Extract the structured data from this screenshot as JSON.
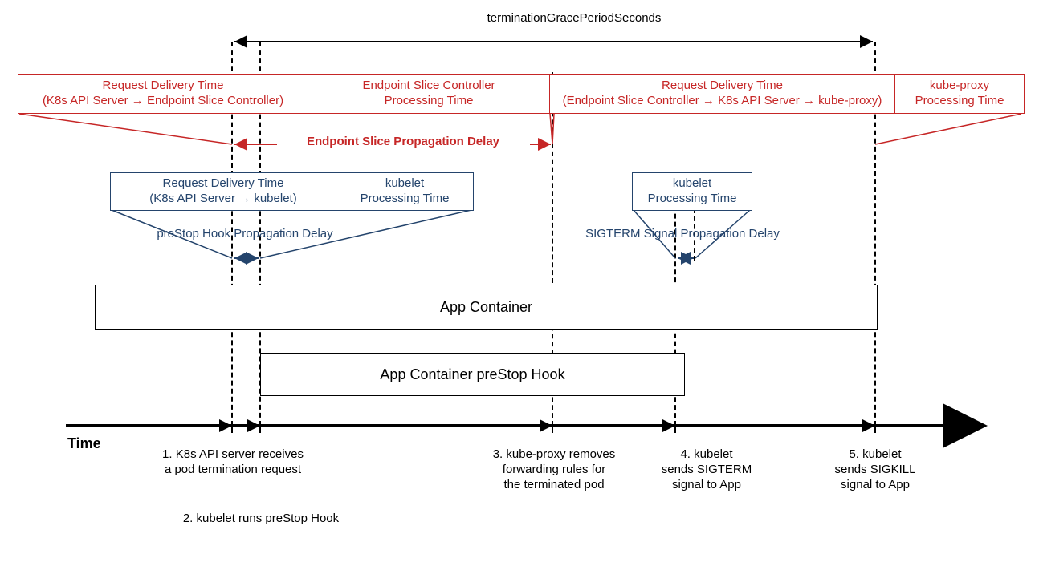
{
  "topSpanLabel": "terminationGracePeriodSeconds",
  "redRow": {
    "b1": {
      "l1": "Request Delivery Time",
      "l2": "(K8s API Server → Endpoint Slice Controller)"
    },
    "b2": {
      "l1": "Endpoint Slice Controller",
      "l2": "Processing Time"
    },
    "b3": {
      "l1": "Request Delivery Time",
      "l2": "(Endpoint Slice Controller → K8s API Server → kube-proxy)"
    },
    "b4": {
      "l1": "kube-proxy",
      "l2": "Processing Time"
    }
  },
  "redSpanLabel": "Endpoint Slice Propagation Delay",
  "blueRow": {
    "b1": {
      "l1": "Request Delivery Time",
      "l2": "(K8s API Server → kubelet)"
    },
    "b2": {
      "l1": "kubelet",
      "l2": "Processing Time"
    },
    "b3": {
      "l1": "kubelet",
      "l2": "Processing Time"
    }
  },
  "blueSpan1": "preStop Hook Propagation Delay",
  "blueSpan2": "SIGTERM Signal Propagation Delay",
  "appContainer": "App Container",
  "preStopHook": "App Container preStop Hook",
  "timeLabel": "Time",
  "events": {
    "e1": {
      "l1": "1. K8s API server receives",
      "l2": "a pod termination request"
    },
    "e2": "2. kubelet runs preStop Hook",
    "e3": {
      "l1": "3. kube-proxy removes",
      "l2": "forwarding rules for",
      "l3": "the terminated pod"
    },
    "e4": {
      "l1": "4. kubelet",
      "l2": "sends SIGTERM",
      "l3": "signal to App"
    },
    "e5": {
      "l1": "5. kubelet",
      "l2": "sends SIGKILL",
      "l3": "signal to App"
    }
  }
}
